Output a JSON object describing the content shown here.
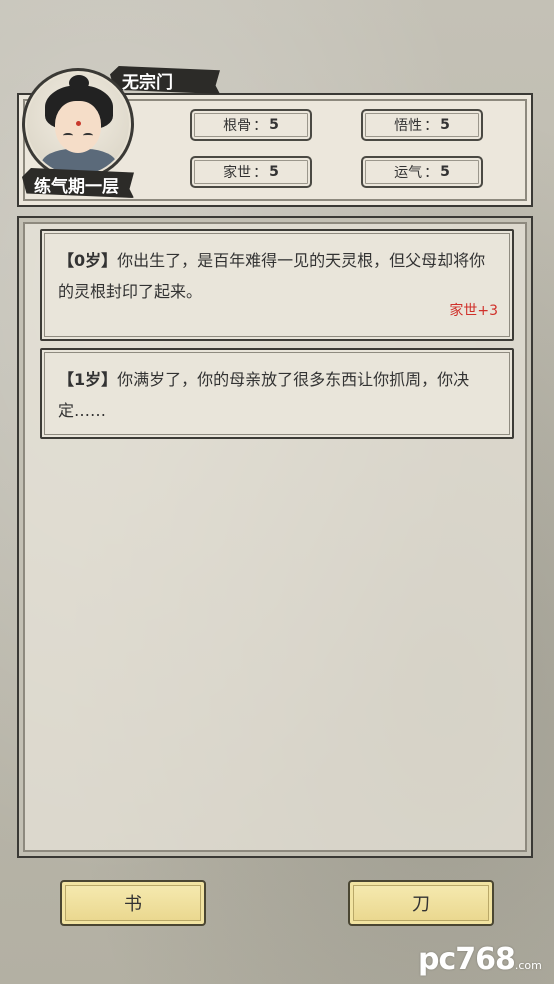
{
  "player": {
    "sect": "无宗门",
    "realm": "练气期一层"
  },
  "stats": [
    {
      "label": "根骨",
      "value": "5"
    },
    {
      "label": "悟性",
      "value": "5"
    },
    {
      "label": "家世",
      "value": "5"
    },
    {
      "label": "运气",
      "value": "5"
    }
  ],
  "log": [
    {
      "age": "【0岁】",
      "text": "你出生了，是百年难得一见的天灵根，但父母却将你的灵根封印了起来。",
      "effect": "家世+3"
    },
    {
      "age": "【1岁】",
      "text": "你满岁了，你的母亲放了很多东西让你抓周，你决定……",
      "effect": ""
    }
  ],
  "choices": [
    {
      "label": "书"
    },
    {
      "label": "刀"
    }
  ],
  "watermark": {
    "text": "pc768",
    "sub": ".com"
  }
}
